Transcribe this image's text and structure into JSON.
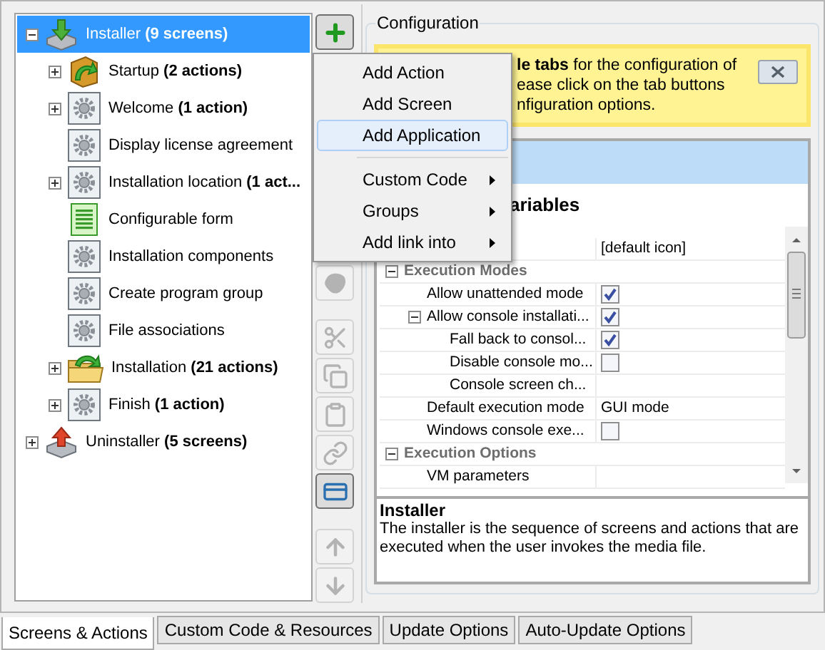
{
  "tree": [
    {
      "label": "Installer **(9 screens)**",
      "kind": "install",
      "selected": true,
      "expanded": true,
      "children": [
        {
          "label": "Startup **(2 actions)**",
          "kind": "package",
          "selected": false,
          "expanded": false
        },
        {
          "label": "Welcome **(1 action)**",
          "kind": "gear",
          "selected": false,
          "expanded": false
        },
        {
          "label": "Display license agreement",
          "kind": "gear",
          "selected": false
        },
        {
          "label": "Installation location **(1 act...**",
          "kind": "gear",
          "selected": false,
          "expanded": false
        },
        {
          "label": "Configurable form",
          "kind": "form",
          "selected": false
        },
        {
          "label": "Installation components",
          "kind": "gear",
          "selected": false
        },
        {
          "label": "Create program group",
          "kind": "gear",
          "selected": false
        },
        {
          "label": "File associations",
          "kind": "gear",
          "selected": false
        },
        {
          "label": "Installation **(21 actions)**",
          "kind": "folder",
          "selected": false,
          "expanded": false
        },
        {
          "label": "Finish **(1 action)**",
          "kind": "gear",
          "selected": false,
          "expanded": false
        }
      ]
    },
    {
      "label": "Uninstaller **(5 screens)**",
      "kind": "uninstall",
      "selected": false,
      "expanded": false
    }
  ],
  "toolbar": {
    "groups": [
      {
        "buttons": [
          {
            "kind": "add",
            "disabled": false,
            "pressed": true
          }
        ]
      },
      {
        "buttons": [
          {
            "kind": "blob",
            "disabled": true,
            "pressed": false
          }
        ]
      },
      {
        "buttons": [
          {
            "kind": "cut",
            "disabled": true,
            "pressed": false
          },
          {
            "kind": "copy",
            "disabled": true,
            "pressed": false
          },
          {
            "kind": "paste",
            "disabled": true,
            "pressed": false
          },
          {
            "kind": "link",
            "disabled": true,
            "pressed": false
          },
          {
            "kind": "card",
            "disabled": false,
            "pressed": true
          }
        ]
      },
      {
        "buttons": [
          {
            "kind": "up",
            "disabled": true,
            "pressed": false
          },
          {
            "kind": "down",
            "disabled": true,
            "pressed": false
          }
        ]
      }
    ]
  },
  "menu": {
    "items": [
      {
        "label": "Add Action",
        "kind": "item",
        "selected": false
      },
      {
        "label": "Add Screen",
        "kind": "item",
        "selected": false
      },
      {
        "label": "Add Application",
        "kind": "item",
        "selected": true
      },
      {
        "label": "Custom Code",
        "kind": "submenu",
        "selected": false
      },
      {
        "label": "Groups",
        "kind": "submenu",
        "selected": false
      },
      {
        "label": "Add link into",
        "kind": "submenu",
        "selected": false
      }
    ]
  },
  "configuration": {
    "title": "Configuration",
    "banner": {
      "lines": [
        "**le tabs** for the configuration of",
        "ease click on the tab buttons",
        "nfiguration options."
      ]
    },
    "section_title": "ariables",
    "properties": [
      {
        "kind": "text",
        "value": "[default icon]"
      },
      {
        "kind": "section",
        "label": "Execution Modes",
        "expanded": true,
        "children": [
          {
            "kind": "check",
            "label": "Allow unattended mode",
            "checked": true
          },
          {
            "kind": "check",
            "label": "Allow console installati...",
            "checked": true,
            "expanded": true,
            "children": [
              {
                "kind": "check",
                "label": "Fall back to consol...",
                "checked": true
              },
              {
                "kind": "check",
                "label": "Disable console mo...",
                "checked": false
              },
              {
                "kind": "text",
                "label": "Console screen ch..."
              }
            ]
          },
          {
            "kind": "text",
            "label": "Default execution mode",
            "value": "GUI mode"
          },
          {
            "kind": "check",
            "label": "Windows console exe...",
            "checked": false
          }
        ]
      },
      {
        "kind": "section",
        "label": "Execution Options",
        "expanded": true,
        "children": [
          {
            "kind": "text",
            "label": "VM parameters"
          }
        ]
      }
    ],
    "description": {
      "title": "Installer",
      "text": "The installer is the sequence of screens and actions that are executed when the user invokes the media file."
    }
  },
  "bottom_tabs": [
    {
      "label": "Screens & Actions",
      "selected": true
    },
    {
      "label": "Custom Code & Resources",
      "selected": false
    },
    {
      "label": "Update Options",
      "selected": false
    },
    {
      "label": "Auto-Update Options",
      "selected": false
    }
  ]
}
